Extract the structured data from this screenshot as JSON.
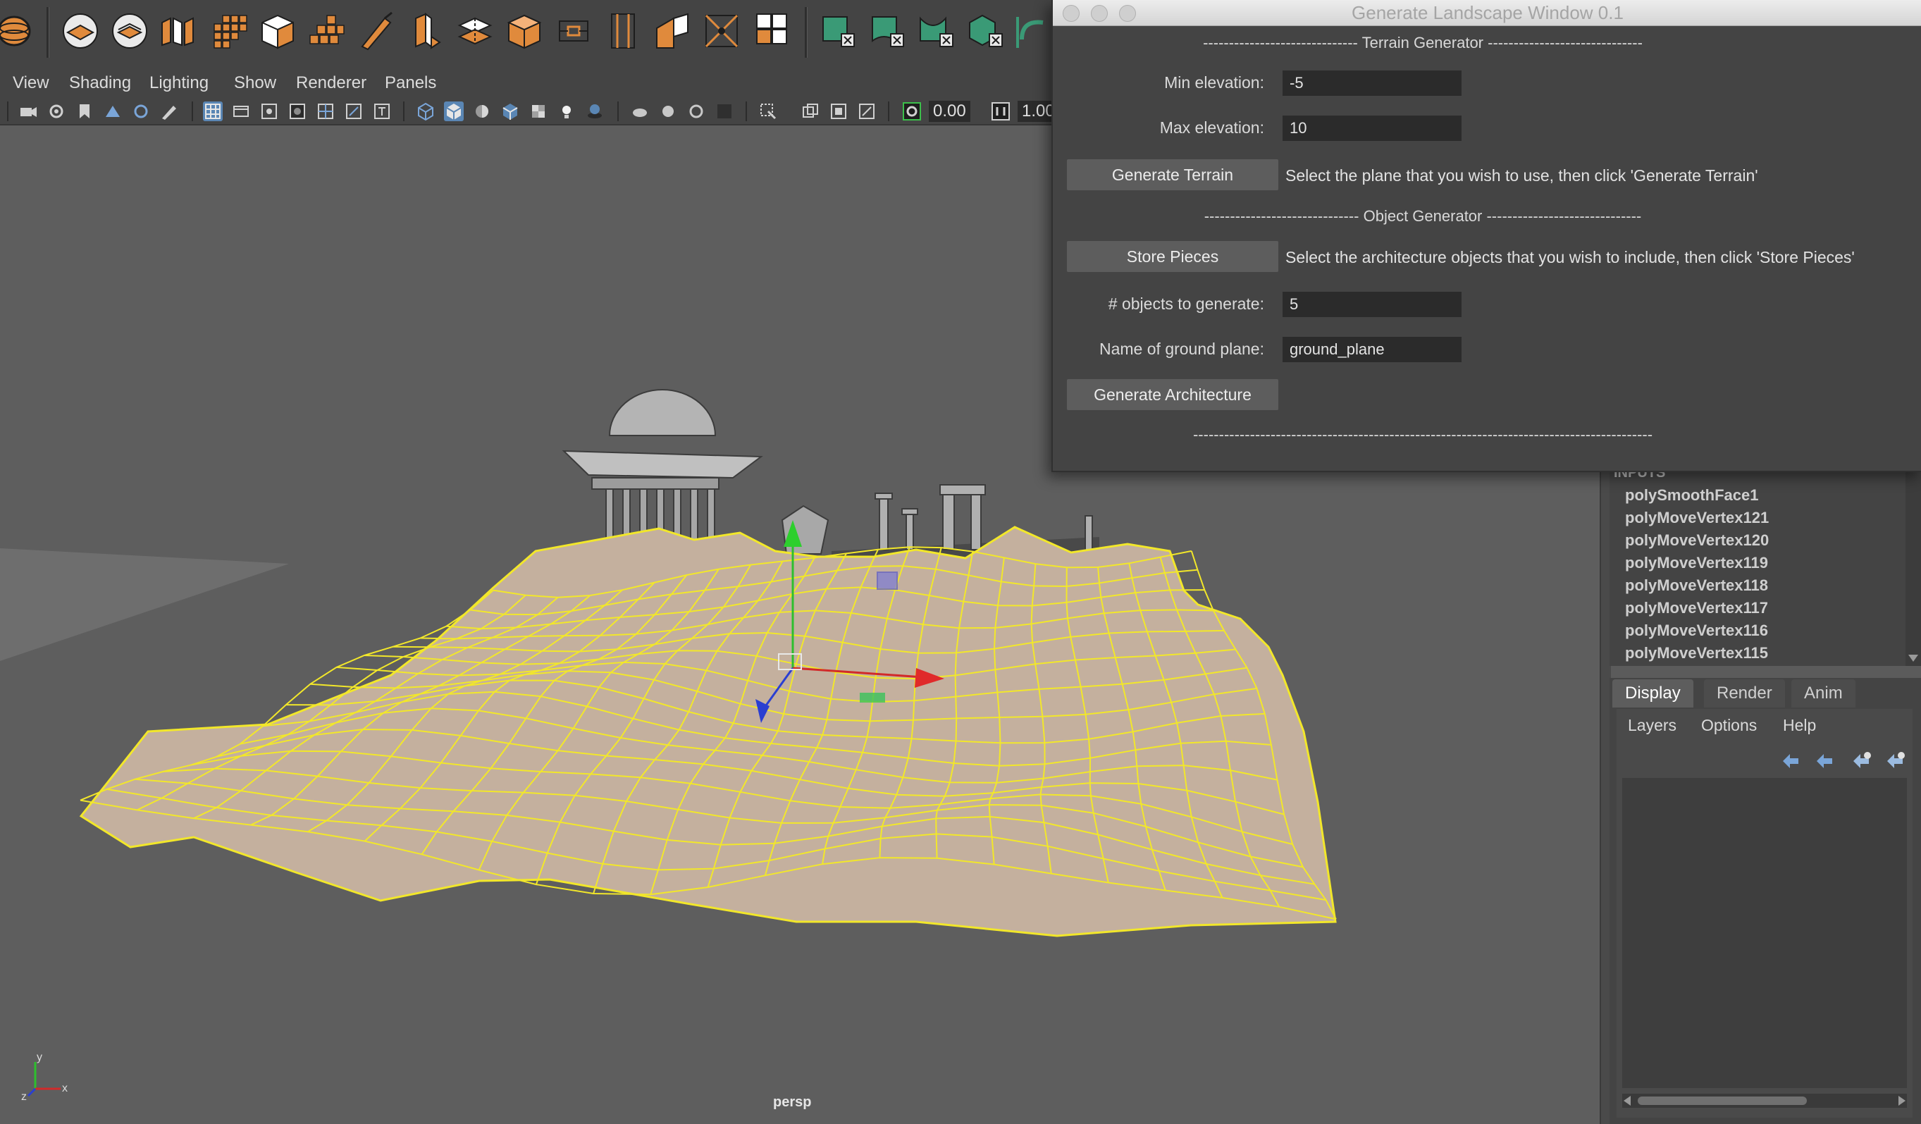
{
  "shelf": {
    "icons": [
      "polygon-sphere-icon",
      "polygon-cube-icon",
      "polygon-cylinder-icon",
      "polygon-plane-icon",
      "polygon-cube-icon",
      "combine-icon",
      "multi-cut-icon",
      "extrude-icon",
      "split-icon",
      "bridge-icon",
      "insert-loop-icon",
      "merge-icon",
      "bevel-icon",
      "target-weld-icon",
      "quad-draw-icon",
      "uv-editor-icon",
      "uv-layout-icon",
      "uv-cut-icon",
      "uv-sew-icon",
      "bend-icon"
    ]
  },
  "viewport_menu": {
    "items": [
      "View",
      "Shading",
      "Lighting",
      "Show",
      "Renderer",
      "Panels"
    ]
  },
  "panel_toolbar": {
    "exposure_value": "0.00",
    "gamma_value": "1.00"
  },
  "viewport": {
    "camera_label": "persp",
    "axis_labels": {
      "y": "y",
      "x": "x",
      "z": "z"
    }
  },
  "inputs_panel": {
    "header": "INPUTS",
    "items": [
      "polySmoothFace1",
      "polyMoveVertex121",
      "polyMoveVertex120",
      "polyMoveVertex119",
      "polyMoveVertex118",
      "polyMoveVertex117",
      "polyMoveVertex116",
      "polyMoveVertex115"
    ]
  },
  "layer_editor": {
    "tabs": [
      "Display",
      "Render",
      "Anim"
    ],
    "active_tab": "Display",
    "menus": [
      "Layers",
      "Options",
      "Help"
    ]
  },
  "gen_window": {
    "title": "Generate Landscape Window 0.1",
    "terrain_section": "------------------------------ Terrain Generator ------------------------------",
    "min_elevation_label": "Min elevation:",
    "min_elevation_value": "-5",
    "max_elevation_label": "Max elevation:",
    "max_elevation_value": "10",
    "generate_terrain_label": "Generate Terrain",
    "generate_terrain_hint": "Select the plane that you wish to use, then click 'Generate Terrain'",
    "object_section": "------------------------------ Object Generator ------------------------------",
    "store_pieces_label": "Store Pieces",
    "store_pieces_hint": "Select the architecture objects that you wish to include, then click 'Store Pieces'",
    "objects_count_label": "# objects to generate:",
    "objects_count_value": "5",
    "ground_plane_label": "Name of ground plane:",
    "ground_plane_value": "ground_plane",
    "generate_architecture_label": "Generate Architecture",
    "bottom_rule": "-----------------------------------------------------------------------------------------"
  },
  "colors": {
    "wireframe": "#f2e72a",
    "terrain_fill": "#c4b09e",
    "viewport_bg": "#5e5e5e",
    "shelf_accent": "#e08a3c",
    "shelf_teal": "#3a9a76"
  }
}
